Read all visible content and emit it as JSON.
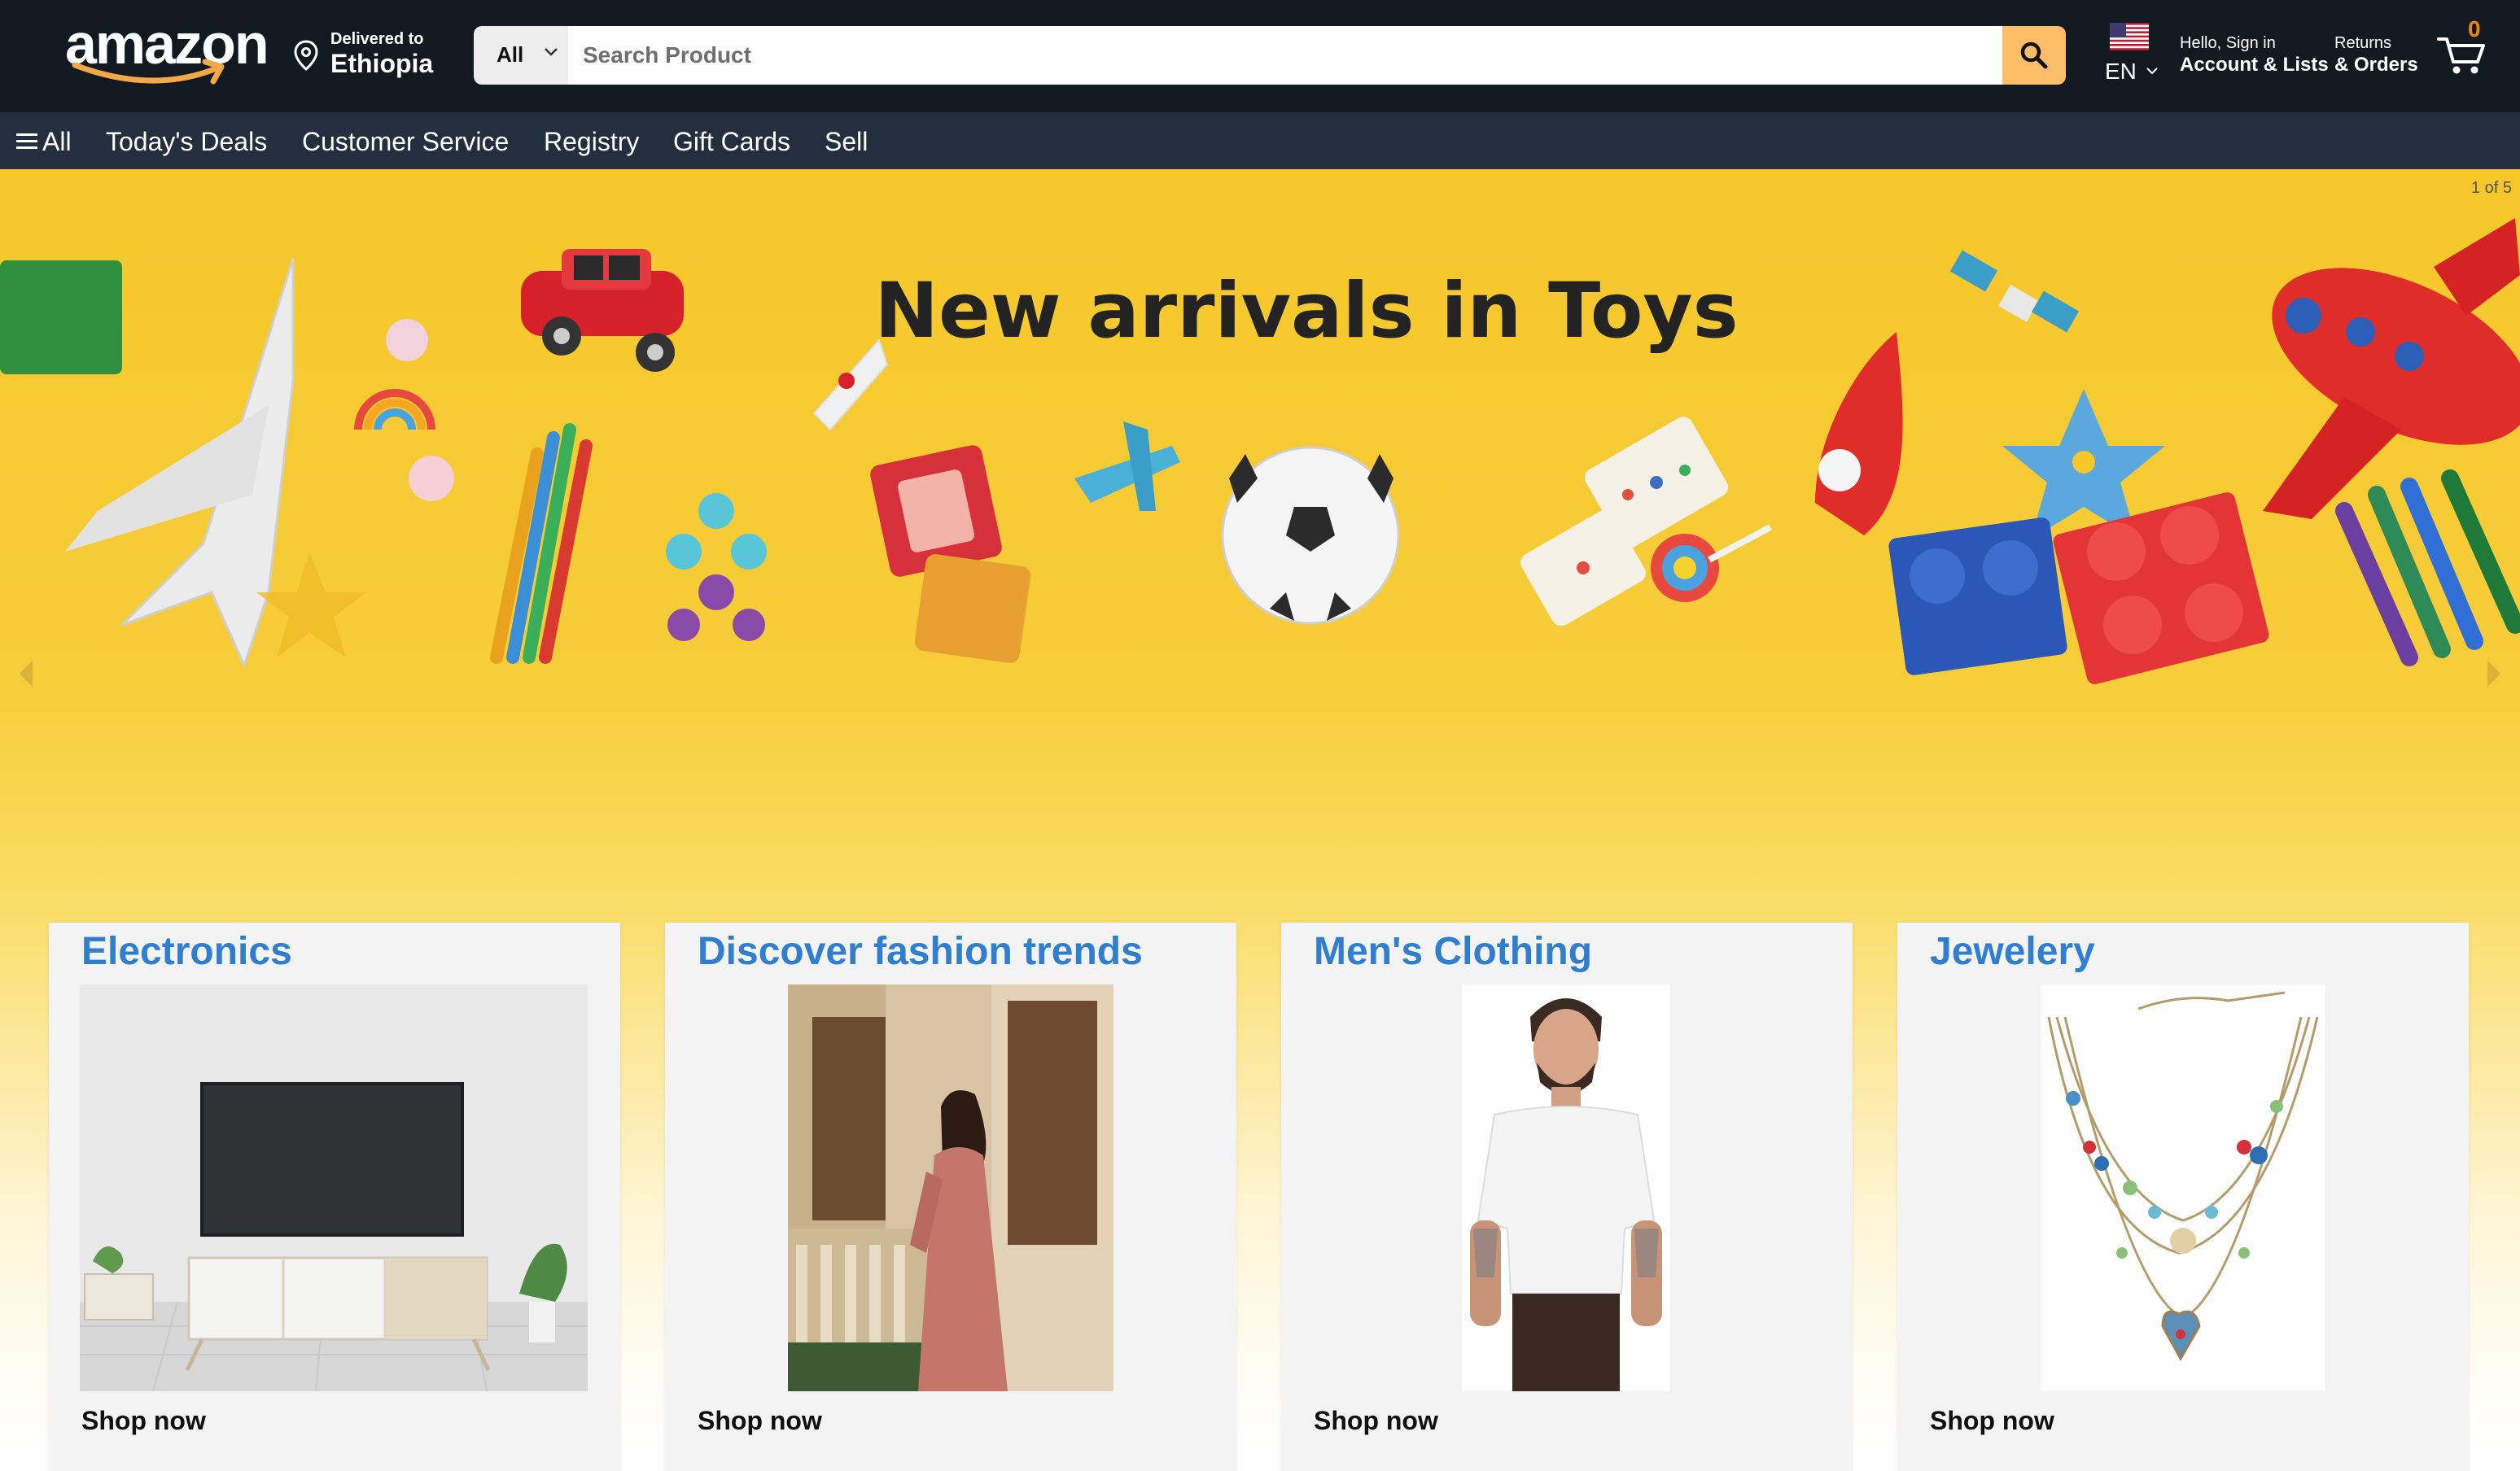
{
  "header": {
    "logo_text": "amazon",
    "deliver_label": "Delivered to",
    "deliver_location": "Ethiopia",
    "search_category": "All",
    "search_placeholder": "Search Product",
    "lang_code": "EN",
    "account_greeting": "Hello, Sign in",
    "account_label": "Account & Lists",
    "returns_label": "Returns",
    "orders_label": "& Orders",
    "cart_count": "0"
  },
  "nav": {
    "all_label": "All",
    "items": [
      "Today's Deals",
      "Customer Service",
      "Registry",
      "Gift Cards",
      "Sell"
    ]
  },
  "hero": {
    "title": "New arrivals in Toys",
    "counter": "1 of 5"
  },
  "cards": [
    {
      "title": "Electronics",
      "link": "Shop now"
    },
    {
      "title": "Discover fashion trends",
      "link": "Shop now"
    },
    {
      "title": "Men's Clothing",
      "link": "Shop now"
    },
    {
      "title": "Jewelery",
      "link": "Shop now"
    }
  ],
  "colors": {
    "header_bg": "#131921",
    "nav_bg": "#232f3e",
    "search_button": "#febd69",
    "card_title": "#2f7ecf",
    "cart_count": "#f08804",
    "hero_yellow": "#f5c72a"
  },
  "icons": [
    "location-pin-icon",
    "search-icon",
    "us-flag-icon",
    "chevron-down-icon",
    "cart-icon",
    "hamburger-icon",
    "chevron-left-icon",
    "chevron-right-icon"
  ]
}
